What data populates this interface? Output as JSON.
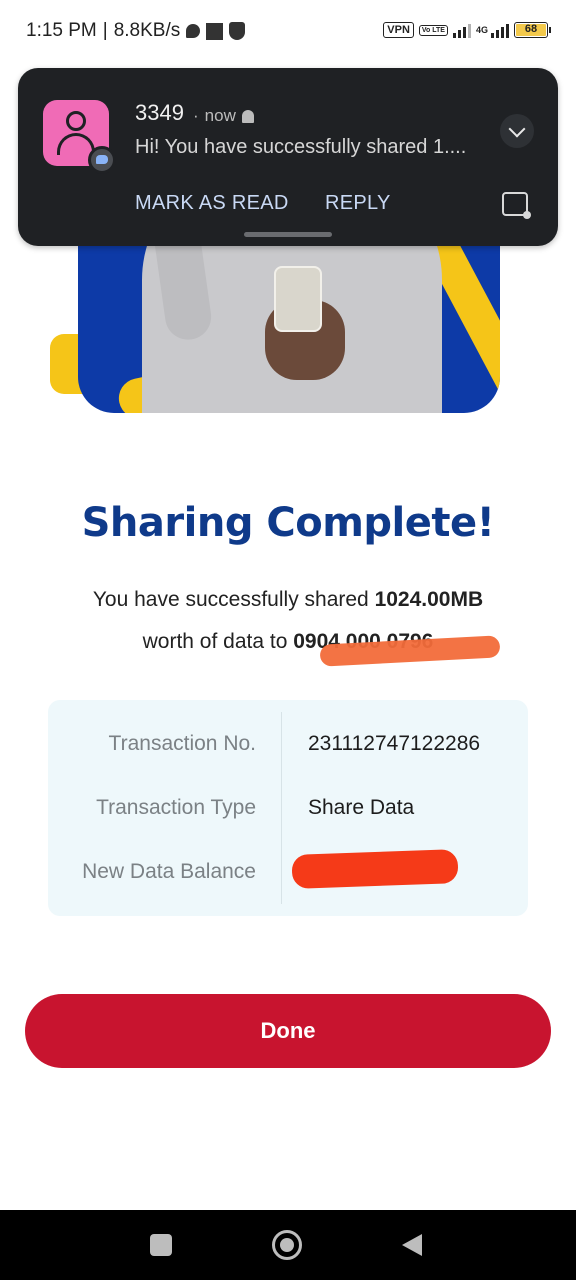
{
  "status_bar": {
    "time": "1:15 PM",
    "speed": "8.8KB/s",
    "vpn": "VPN",
    "volte": "Vo LTE",
    "network": "4G",
    "battery": "68"
  },
  "notification": {
    "sender": "3349",
    "time": "now",
    "message": "Hi! You have successfully shared 1....",
    "actions": {
      "mark_as_read": "MARK AS READ",
      "reply": "REPLY"
    }
  },
  "main": {
    "title": "Sharing Complete!",
    "desc_line1_prefix": "You have successfully shared ",
    "desc_line1_amount": "1024.00MB",
    "desc_line2_prefix": "worth of data to ",
    "desc_line2_number": "0904 000 0796"
  },
  "transaction": {
    "rows": [
      {
        "label": "Transaction No.",
        "value": "231112747122286"
      },
      {
        "label": "Transaction Type",
        "value": "Share Data"
      },
      {
        "label": "New Data Balance",
        "value": ""
      }
    ]
  },
  "done_button": "Done",
  "colors": {
    "title": "#0f3a8a",
    "button": "#c8142f",
    "card_bg": "#eef8fb",
    "hero_blue": "#0d3aa7",
    "hero_yellow": "#f5c518"
  }
}
